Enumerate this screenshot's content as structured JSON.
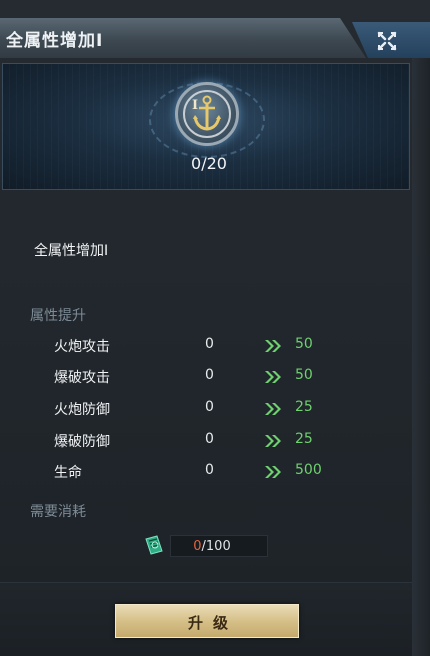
{
  "title": "全属性增加I",
  "banner": {
    "roman": "I",
    "progress": "0/20"
  },
  "skill_name": "全属性增加I",
  "attributes_label": "属性提升",
  "attributes": [
    {
      "name": "火炮攻击",
      "current": "0",
      "next": "50"
    },
    {
      "name": "爆破攻击",
      "current": "0",
      "next": "50"
    },
    {
      "name": "火炮防御",
      "current": "0",
      "next": "25"
    },
    {
      "name": "爆破防御",
      "current": "0",
      "next": "25"
    },
    {
      "name": "生命",
      "current": "0",
      "next": "500"
    }
  ],
  "cost_label": "需要消耗",
  "cost": {
    "have": "0",
    "need": "/100"
  },
  "upgrade_label": "升级",
  "icons": {
    "close": "close-icon",
    "medal": "anchor-icon",
    "arrow": "double-chevron-right-icon",
    "cost_item": "book-item-icon"
  },
  "colors": {
    "next_value": "#6fd16f",
    "cost_have": "#e8643c",
    "button": "#d6c089"
  }
}
